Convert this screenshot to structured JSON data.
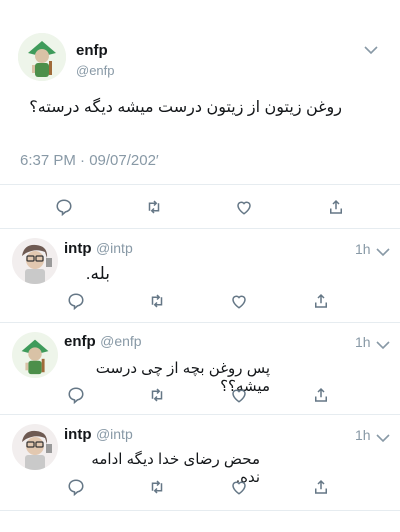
{
  "main_tweet": {
    "name": "enfp",
    "handle": "@enfp",
    "text": "روغن زیتون از زیتون درست میشه دیگه درسته؟",
    "timestamp": "6:37 PM · 09/07/202′"
  },
  "replies": [
    {
      "name": "intp",
      "handle": "@intp",
      "time": "1h",
      "text": "بله."
    },
    {
      "name": "enfp",
      "handle": "@enfp",
      "time": "1h",
      "text": "پس روغن بچه از چی درست میشه؟؟"
    },
    {
      "name": "intp",
      "handle": "@intp",
      "time": "1h",
      "text": "محض رضای خدا دیگه ادامه نده."
    }
  ],
  "colors": {
    "icon": "#657786",
    "muted": "#8899a6",
    "divider": "#e6ecf0"
  },
  "icons": [
    "reply-icon",
    "retweet-icon",
    "like-icon",
    "share-icon",
    "chevron-down-icon"
  ]
}
